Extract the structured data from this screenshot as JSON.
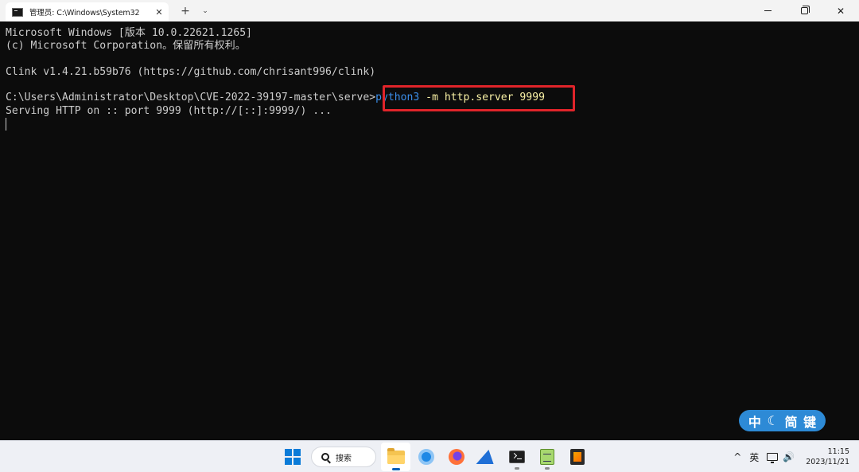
{
  "window": {
    "tab_title": "管理员: C:\\Windows\\System32",
    "tab_close": "✕",
    "new_tab": "+",
    "dropdown": "⌄",
    "minimize_label": "",
    "close": "✕"
  },
  "terminal": {
    "lines": [
      "Microsoft Windows [版本 10.0.22621.1265]",
      "(c) Microsoft Corporation。保留所有权利。",
      "",
      "Clink v1.4.21.b59b76 (https://github.com/chrisant996/clink)",
      ""
    ],
    "prompt": "C:\\Users\\Administrator\\Desktop\\CVE-2022-39197-master\\serve>",
    "command_program": "python3",
    "command_args": " -m http.server 9999",
    "output": "Serving HTTP on :: port 9999 (http://[::]:9999/) ..."
  },
  "ime": {
    "chars": [
      "中",
      "☾",
      "简",
      "键"
    ]
  },
  "taskbar": {
    "search_label": "搜索",
    "icons": [
      "start-icon",
      "file-explorer-icon",
      "chrome-icon",
      "firefox-icon",
      "wireshark-icon",
      "terminal-icon",
      "notepad-icon",
      "burp-icon"
    ],
    "tray": {
      "chevron": "^",
      "lang": "英",
      "speaker": "🔊",
      "time": "11:15",
      "date": "2023/11/21"
    }
  }
}
